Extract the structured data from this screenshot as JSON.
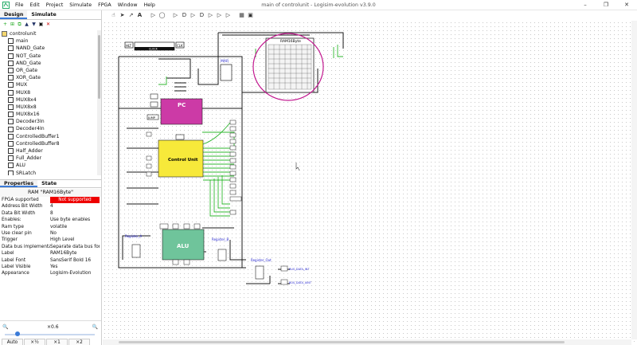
{
  "window": {
    "title": "main of controlunit - Logisim-evolution v3.9.0",
    "menu": [
      "File",
      "Edit",
      "Project",
      "Simulate",
      "FPGA",
      "Window",
      "Help"
    ],
    "controls": [
      "–",
      "❐",
      "✕"
    ]
  },
  "left_tabs": [
    "Design",
    "Simulate"
  ],
  "tree": {
    "root": "controlunit",
    "items": [
      "main",
      "NAND_Gate",
      "NOT_Gate",
      "AND_Gate",
      "OR_Gate",
      "XOR_Gate",
      "MUX",
      "MUX8",
      "MUX8x4",
      "MUX8x8",
      "MUX8x16",
      "Decoder3In",
      "Decoder4In",
      "ControlledBuffer1",
      "ControlledBuffer8",
      "Half_Adder",
      "Full_Adder",
      "ALU",
      "SRLatch"
    ]
  },
  "bottom_tabs": [
    "Properties",
    "State"
  ],
  "props_title": "RAM \"RAM16Byte\"",
  "properties": [
    {
      "k": "FPGA supported",
      "v": "Not supported",
      "bad": true
    },
    {
      "k": "Address Bit Width",
      "v": "4"
    },
    {
      "k": "Data Bit Width",
      "v": "8"
    },
    {
      "k": "Enables:",
      "v": "Use byte enables"
    },
    {
      "k": "Ram type",
      "v": "volatile"
    },
    {
      "k": "Use clear pin",
      "v": "No"
    },
    {
      "k": "Trigger",
      "v": "High Level"
    },
    {
      "k": "Data bus implementat...",
      "v": "Separate data bus for..."
    },
    {
      "k": "Label",
      "v": "RAM16Byte"
    },
    {
      "k": "Label Font",
      "v": "SansSerif Bold 16"
    },
    {
      "k": "Label Visible",
      "v": "Yes"
    },
    {
      "k": "Appearance",
      "v": "Logisim-Evolution"
    }
  ],
  "zoom": {
    "level": "×0.6",
    "buttons": [
      "Auto",
      "×½",
      "×1",
      "×2"
    ]
  },
  "circuit": {
    "labels": {
      "ram": "RAM16Byte",
      "pc": "PC",
      "cu": "Control Unit",
      "alu": "ALU",
      "mar": "MAR",
      "reg_a": "Register_A",
      "reg_b": "Register_B",
      "reg_out": "Register_Out",
      "clock": "CLOCK",
      "hlt": "HLT",
      "clk": "CLK",
      "jump": "JUMP",
      "bus_int": "BUS_DATA_INT",
      "bus_uint": "BUS_DATA_UINT"
    },
    "colors": {
      "pc": "#cc3aa6",
      "cu": "#f7e93a",
      "alu": "#6fc49b",
      "wire": "#1a1a1a",
      "active_wire": "#2db52d",
      "highlight": "#c2188f"
    }
  }
}
